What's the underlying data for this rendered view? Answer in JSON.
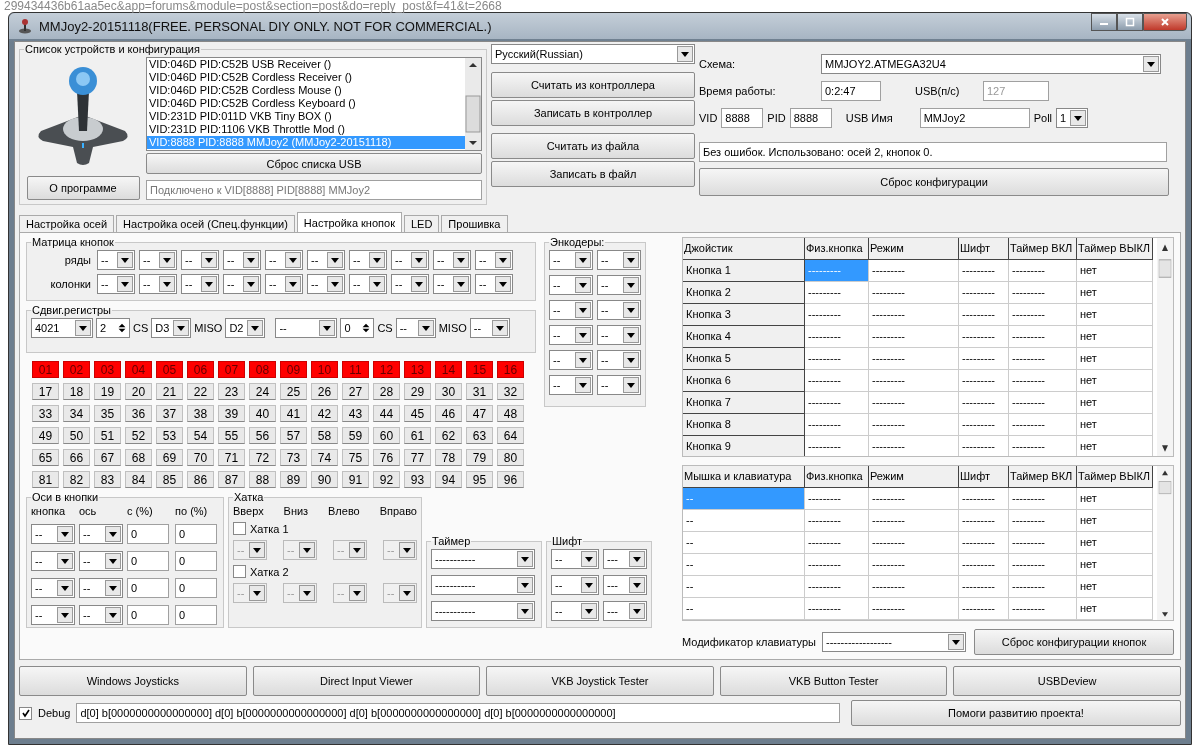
{
  "backdrop_text": "299434436b61aa5ec&app=forums&module=post&section=post&do=reply_post&f=41&t=2668",
  "window": {
    "title": "MMJoy2-20151118(FREE. PERSONAL DIY ONLY. NOT FOR COMMERCIAL.)"
  },
  "device_group": {
    "title": "Список устройств и конфигурация",
    "devices": [
      {
        "label": "VID:046D PID:C52B USB Receiver ()",
        "selected": false
      },
      {
        "label": "VID:046D PID:C52B Cordless Receiver ()",
        "selected": false
      },
      {
        "label": "VID:046D PID:C52B Cordless Mouse ()",
        "selected": false
      },
      {
        "label": "VID:046D PID:C52B Cordless Keyboard ()",
        "selected": false
      },
      {
        "label": "VID:231D PID:011D VKB Tiny BOX  ()",
        "selected": false
      },
      {
        "label": "VID:231D PID:1106 VKB Throttle Mod ()",
        "selected": false
      },
      {
        "label": "VID:8888 PID:8888 MMJoy2 (MMJoy2-20151118)",
        "selected": true
      }
    ],
    "reset_usb_button": "Сброс списка USB",
    "about_button": "О программе",
    "connection_status": "Подключено к VID[8888] PID[8888] MMJoy2"
  },
  "language": "Русский(Russian)",
  "controller_buttons": [
    "Считать из контроллера",
    "Записать в контроллер",
    "Считать из файла",
    "Записать в файл"
  ],
  "config": {
    "scheme_label": "Схема:",
    "scheme": "MMJOY2.ATMEGA32U4",
    "uptime_label": "Время работы:",
    "uptime": "0:2:47",
    "usb_rate_label": "USB(п/с)",
    "usb_rate": "127",
    "vid_label": "VID",
    "vid": "8888",
    "pid_label": "PID",
    "pid": "8888",
    "usb_name_label": "USB Имя",
    "usb_name": "MMJoy2",
    "poll_label": "Poll",
    "poll": "1",
    "status": "Без ошибок. Использовано: осей  2, кнопок  0.",
    "reset_button": "Сброс конфигурации"
  },
  "tabs": [
    {
      "label": "Настройка осей",
      "selected": false
    },
    {
      "label": "Настройка осей (Спец.функции)",
      "selected": false
    },
    {
      "label": "Настройка кнопок",
      "selected": true
    },
    {
      "label": "LED",
      "selected": false
    },
    {
      "label": "Прошивка",
      "selected": false
    }
  ],
  "matrix": {
    "title": "Матрица кнопок",
    "rows_label": "ряды",
    "columns_label": "колонки",
    "rows": [
      "--",
      "--",
      "--",
      "--",
      "--",
      "--",
      "--",
      "--",
      "--",
      "--"
    ],
    "columns": [
      "--",
      "--",
      "--",
      "--",
      "--",
      "--",
      "--",
      "--",
      "--",
      "--"
    ]
  },
  "shift_registers": {
    "title": "Сдвиг.регистры",
    "units": [
      {
        "chip": "4021",
        "count": "2",
        "cs_label": "CS",
        "cs": "D3",
        "miso_label": "MISO",
        "miso": "D2"
      },
      {
        "chip": "--",
        "count": "0",
        "cs_label": "CS",
        "cs": "--",
        "miso_label": "MISO",
        "miso": "--"
      }
    ]
  },
  "encoders": {
    "title": "Энкодеры:",
    "pairs": [
      [
        "--",
        "--"
      ],
      [
        "--",
        "--"
      ],
      [
        "--",
        "--"
      ],
      [
        "--",
        "--"
      ],
      [
        "--",
        "--"
      ],
      [
        "--",
        "--"
      ]
    ]
  },
  "button_states": [
    {
      "label": "01",
      "pressed": true
    },
    {
      "label": "02",
      "pressed": true
    },
    {
      "label": "03",
      "pressed": true
    },
    {
      "label": "04",
      "pressed": true
    },
    {
      "label": "05",
      "pressed": true
    },
    {
      "label": "06",
      "pressed": true
    },
    {
      "label": "07",
      "pressed": true
    },
    {
      "label": "08",
      "pressed": true
    },
    {
      "label": "09",
      "pressed": true
    },
    {
      "label": "10",
      "pressed": true
    },
    {
      "label": "11",
      "pressed": true
    },
    {
      "label": "12",
      "pressed": true
    },
    {
      "label": "13",
      "pressed": true
    },
    {
      "label": "14",
      "pressed": true
    },
    {
      "label": "15",
      "pressed": true
    },
    {
      "label": "16",
      "pressed": true
    },
    {
      "label": "17",
      "pressed": false
    },
    {
      "label": "18",
      "pressed": false
    },
    {
      "label": "19",
      "pressed": false
    },
    {
      "label": "20",
      "pressed": false
    },
    {
      "label": "21",
      "pressed": false
    },
    {
      "label": "22",
      "pressed": false
    },
    {
      "label": "23",
      "pressed": false
    },
    {
      "label": "24",
      "pressed": false
    },
    {
      "label": "25",
      "pressed": false
    },
    {
      "label": "26",
      "pressed": false
    },
    {
      "label": "27",
      "pressed": false
    },
    {
      "label": "28",
      "pressed": false
    },
    {
      "label": "29",
      "pressed": false
    },
    {
      "label": "30",
      "pressed": false
    },
    {
      "label": "31",
      "pressed": false
    },
    {
      "label": "32",
      "pressed": false
    },
    {
      "label": "33",
      "pressed": false
    },
    {
      "label": "34",
      "pressed": false
    },
    {
      "label": "35",
      "pressed": false
    },
    {
      "label": "36",
      "pressed": false
    },
    {
      "label": "37",
      "pressed": false
    },
    {
      "label": "38",
      "pressed": false
    },
    {
      "label": "39",
      "pressed": false
    },
    {
      "label": "40",
      "pressed": false
    },
    {
      "label": "41",
      "pressed": false
    },
    {
      "label": "42",
      "pressed": false
    },
    {
      "label": "43",
      "pressed": false
    },
    {
      "label": "44",
      "pressed": false
    },
    {
      "label": "45",
      "pressed": false
    },
    {
      "label": "46",
      "pressed": false
    },
    {
      "label": "47",
      "pressed": false
    },
    {
      "label": "48",
      "pressed": false
    },
    {
      "label": "49",
      "pressed": false
    },
    {
      "label": "50",
      "pressed": false
    },
    {
      "label": "51",
      "pressed": false
    },
    {
      "label": "52",
      "pressed": false
    },
    {
      "label": "53",
      "pressed": false
    },
    {
      "label": "54",
      "pressed": false
    },
    {
      "label": "55",
      "pressed": false
    },
    {
      "label": "56",
      "pressed": false
    },
    {
      "label": "57",
      "pressed": false
    },
    {
      "label": "58",
      "pressed": false
    },
    {
      "label": "59",
      "pressed": false
    },
    {
      "label": "60",
      "pressed": false
    },
    {
      "label": "61",
      "pressed": false
    },
    {
      "label": "62",
      "pressed": false
    },
    {
      "label": "63",
      "pressed": false
    },
    {
      "label": "64",
      "pressed": false
    },
    {
      "label": "65",
      "pressed": false
    },
    {
      "label": "66",
      "pressed": false
    },
    {
      "label": "67",
      "pressed": false
    },
    {
      "label": "68",
      "pressed": false
    },
    {
      "label": "69",
      "pressed": false
    },
    {
      "label": "70",
      "pressed": false
    },
    {
      "label": "71",
      "pressed": false
    },
    {
      "label": "72",
      "pressed": false
    },
    {
      "label": "73",
      "pressed": false
    },
    {
      "label": "74",
      "pressed": false
    },
    {
      "label": "75",
      "pressed": false
    },
    {
      "label": "76",
      "pressed": false
    },
    {
      "label": "77",
      "pressed": false
    },
    {
      "label": "78",
      "pressed": false
    },
    {
      "label": "79",
      "pressed": false
    },
    {
      "label": "80",
      "pressed": false
    },
    {
      "label": "81",
      "pressed": false
    },
    {
      "label": "82",
      "pressed": false
    },
    {
      "label": "83",
      "pressed": false
    },
    {
      "label": "84",
      "pressed": false
    },
    {
      "label": "85",
      "pressed": false
    },
    {
      "label": "86",
      "pressed": false
    },
    {
      "label": "87",
      "pressed": false
    },
    {
      "label": "88",
      "pressed": false
    },
    {
      "label": "89",
      "pressed": false
    },
    {
      "label": "90",
      "pressed": false
    },
    {
      "label": "91",
      "pressed": false
    },
    {
      "label": "92",
      "pressed": false
    },
    {
      "label": "93",
      "pressed": false
    },
    {
      "label": "94",
      "pressed": false
    },
    {
      "label": "95",
      "pressed": false
    },
    {
      "label": "96",
      "pressed": false
    }
  ],
  "axes_to_buttons": {
    "title": "Оси в кнопки",
    "headers": [
      "кнопка",
      "ось",
      "с (%)",
      "по (%)"
    ],
    "rows": [
      {
        "button": "--",
        "axis": "--",
        "from": "0",
        "to": "0"
      },
      {
        "button": "--",
        "axis": "--",
        "from": "0",
        "to": "0"
      },
      {
        "button": "--",
        "axis": "--",
        "from": "0",
        "to": "0"
      },
      {
        "button": "--",
        "axis": "--",
        "from": "0",
        "to": "0"
      }
    ]
  },
  "hat": {
    "title": "Хатка",
    "directions": [
      "Вверх",
      "Вниз",
      "Влево",
      "Вправо"
    ],
    "hats": [
      {
        "label": "Хатка 1",
        "checked": false,
        "values": [
          "--",
          "--",
          "--",
          "--"
        ]
      },
      {
        "label": "Хатка 2",
        "checked": false,
        "values": [
          "--",
          "--",
          "--",
          "--"
        ]
      }
    ]
  },
  "timer": {
    "title": "Таймер",
    "values": [
      "-----------",
      "-----------",
      "-----------"
    ]
  },
  "shift": {
    "title": "Шифт",
    "pairs": [
      [
        "--",
        "---"
      ],
      [
        "--",
        "---"
      ],
      [
        "--",
        "---"
      ]
    ]
  },
  "joystick_table": {
    "columns": [
      "Джойстик",
      "Физ.кнопка",
      "Режим",
      "Шифт",
      "Таймер ВКЛ",
      "Таймер ВЫКЛ"
    ],
    "rows": [
      {
        "cells": [
          {
            "text": "Кнопка 1",
            "selected": false
          },
          {
            "text": "---------",
            "selected": true
          },
          {
            "text": "---------",
            "selected": false
          },
          {
            "text": "---------",
            "selected": false
          },
          {
            "text": "---------",
            "selected": false
          },
          {
            "text": "нет",
            "selected": false
          }
        ]
      },
      {
        "cells": [
          {
            "text": "Кнопка 2",
            "selected": false
          },
          {
            "text": "---------",
            "selected": false
          },
          {
            "text": "---------",
            "selected": false
          },
          {
            "text": "---------",
            "selected": false
          },
          {
            "text": "---------",
            "selected": false
          },
          {
            "text": "нет",
            "selected": false
          }
        ]
      },
      {
        "cells": [
          {
            "text": "Кнопка 3",
            "selected": false
          },
          {
            "text": "---------",
            "selected": false
          },
          {
            "text": "---------",
            "selected": false
          },
          {
            "text": "---------",
            "selected": false
          },
          {
            "text": "---------",
            "selected": false
          },
          {
            "text": "нет",
            "selected": false
          }
        ]
      },
      {
        "cells": [
          {
            "text": "Кнопка 4",
            "selected": false
          },
          {
            "text": "---------",
            "selected": false
          },
          {
            "text": "---------",
            "selected": false
          },
          {
            "text": "---------",
            "selected": false
          },
          {
            "text": "---------",
            "selected": false
          },
          {
            "text": "нет",
            "selected": false
          }
        ]
      },
      {
        "cells": [
          {
            "text": "Кнопка 5",
            "selected": false
          },
          {
            "text": "---------",
            "selected": false
          },
          {
            "text": "---------",
            "selected": false
          },
          {
            "text": "---------",
            "selected": false
          },
          {
            "text": "---------",
            "selected": false
          },
          {
            "text": "нет",
            "selected": false
          }
        ]
      },
      {
        "cells": [
          {
            "text": "Кнопка 6",
            "selected": false
          },
          {
            "text": "---------",
            "selected": false
          },
          {
            "text": "---------",
            "selected": false
          },
          {
            "text": "---------",
            "selected": false
          },
          {
            "text": "---------",
            "selected": false
          },
          {
            "text": "нет",
            "selected": false
          }
        ]
      },
      {
        "cells": [
          {
            "text": "Кнопка 7",
            "selected": false
          },
          {
            "text": "---------",
            "selected": false
          },
          {
            "text": "---------",
            "selected": false
          },
          {
            "text": "---------",
            "selected": false
          },
          {
            "text": "---------",
            "selected": false
          },
          {
            "text": "нет",
            "selected": false
          }
        ]
      },
      {
        "cells": [
          {
            "text": "Кнопка 8",
            "selected": false
          },
          {
            "text": "---------",
            "selected": false
          },
          {
            "text": "---------",
            "selected": false
          },
          {
            "text": "---------",
            "selected": false
          },
          {
            "text": "---------",
            "selected": false
          },
          {
            "text": "нет",
            "selected": false
          }
        ]
      },
      {
        "cells": [
          {
            "text": "Кнопка 9",
            "selected": false
          },
          {
            "text": "---------",
            "selected": false
          },
          {
            "text": "---------",
            "selected": false
          },
          {
            "text": "---------",
            "selected": false
          },
          {
            "text": "---------",
            "selected": false
          },
          {
            "text": "нет",
            "selected": false
          }
        ]
      }
    ]
  },
  "mouse_table": {
    "columns": [
      "Мышка и клавиатура",
      "Физ.кнопка",
      "Режим",
      "Шифт",
      "Таймер ВКЛ",
      "Таймер ВЫКЛ"
    ],
    "rows": [
      {
        "cells": [
          {
            "text": "--",
            "selected": true
          },
          {
            "text": "---------",
            "selected": false
          },
          {
            "text": "---------",
            "selected": false
          },
          {
            "text": "---------",
            "selected": false
          },
          {
            "text": "---------",
            "selected": false
          },
          {
            "text": "нет",
            "selected": false
          }
        ]
      },
      {
        "cells": [
          {
            "text": "--",
            "selected": false
          },
          {
            "text": "---------",
            "selected": false
          },
          {
            "text": "---------",
            "selected": false
          },
          {
            "text": "---------",
            "selected": false
          },
          {
            "text": "---------",
            "selected": false
          },
          {
            "text": "нет",
            "selected": false
          }
        ]
      },
      {
        "cells": [
          {
            "text": "--",
            "selected": false
          },
          {
            "text": "---------",
            "selected": false
          },
          {
            "text": "---------",
            "selected": false
          },
          {
            "text": "---------",
            "selected": false
          },
          {
            "text": "---------",
            "selected": false
          },
          {
            "text": "нет",
            "selected": false
          }
        ]
      },
      {
        "cells": [
          {
            "text": "--",
            "selected": false
          },
          {
            "text": "---------",
            "selected": false
          },
          {
            "text": "---------",
            "selected": false
          },
          {
            "text": "---------",
            "selected": false
          },
          {
            "text": "---------",
            "selected": false
          },
          {
            "text": "нет",
            "selected": false
          }
        ]
      },
      {
        "cells": [
          {
            "text": "--",
            "selected": false
          },
          {
            "text": "---------",
            "selected": false
          },
          {
            "text": "---------",
            "selected": false
          },
          {
            "text": "---------",
            "selected": false
          },
          {
            "text": "---------",
            "selected": false
          },
          {
            "text": "нет",
            "selected": false
          }
        ]
      },
      {
        "cells": [
          {
            "text": "--",
            "selected": false
          },
          {
            "text": "---------",
            "selected": false
          },
          {
            "text": "---------",
            "selected": false
          },
          {
            "text": "---------",
            "selected": false
          },
          {
            "text": "---------",
            "selected": false
          },
          {
            "text": "нет",
            "selected": false
          }
        ]
      }
    ]
  },
  "modifier": {
    "label": "Модификатор клавиатуры",
    "value": "------------------"
  },
  "reset_buttons_button": "Сброс конфигурации кнопок",
  "tools": [
    "Windows Joysticks",
    "Direct Input Viewer",
    "VKB Joystick Tester",
    "VKB Button Tester",
    "USBDeview"
  ],
  "debug": {
    "label": "Debug",
    "checked": true,
    "output": "d[0] b[0000000000000000]   d[0] b[0000000000000000]   d[0] b[0000000000000000]   d[0] b[0000000000000000]"
  },
  "support_button": "Помоги развитию проекта!"
}
